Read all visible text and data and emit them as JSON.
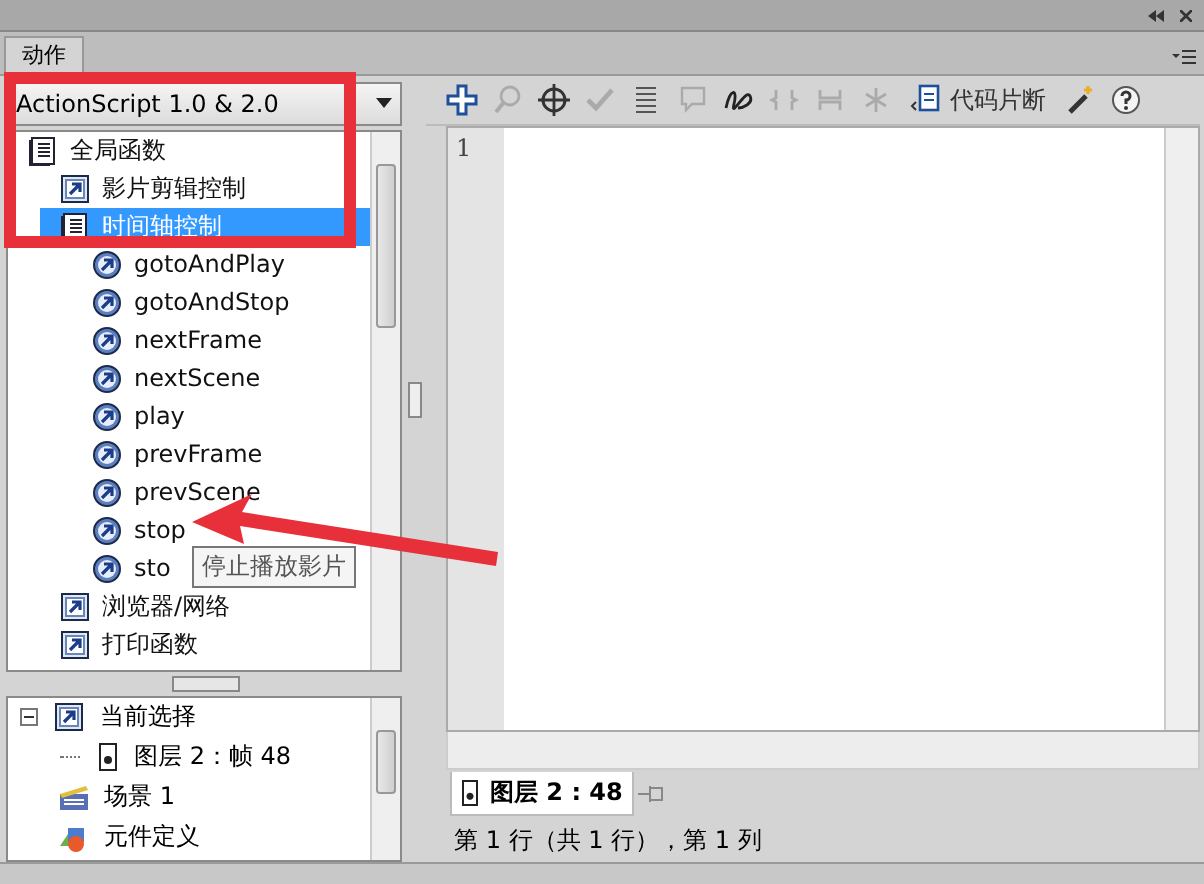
{
  "panel": {
    "tab": "动作"
  },
  "version_dropdown": {
    "value": "ActionScript 1.0 & 2.0"
  },
  "action_tree": [
    {
      "label": "全局函数",
      "kind": "book",
      "selected": false,
      "children": [
        {
          "label": "影片剪辑控制",
          "kind": "category",
          "selected": false
        },
        {
          "label": "时间轴控制",
          "kind": "book",
          "selected": true,
          "children": [
            {
              "label": "gotoAndPlay",
              "kind": "function",
              "selected": false
            },
            {
              "label": "gotoAndStop",
              "kind": "function",
              "selected": false
            },
            {
              "label": "nextFrame",
              "kind": "function",
              "selected": false
            },
            {
              "label": "nextScene",
              "kind": "function",
              "selected": false
            },
            {
              "label": "play",
              "kind": "function",
              "selected": false
            },
            {
              "label": "prevFrame",
              "kind": "function",
              "selected": false
            },
            {
              "label": "prevScene",
              "kind": "function",
              "selected": false
            },
            {
              "label": "stop",
              "kind": "function",
              "selected": false
            },
            {
              "label": "sto",
              "kind": "function",
              "selected": false
            }
          ]
        },
        {
          "label": "浏览器/网络",
          "kind": "category",
          "selected": false
        },
        {
          "label": "打印函数",
          "kind": "category",
          "selected": false
        }
      ]
    }
  ],
  "tooltip": "停止播放影片",
  "script_navigator": [
    {
      "label": "当前选择",
      "kind": "category",
      "expanded": true,
      "children": [
        {
          "label": "图层 2：帧 48",
          "kind": "frame"
        }
      ]
    },
    {
      "label": "场景 1",
      "kind": "scene"
    },
    {
      "label": "元件定义",
      "kind": "symbols"
    }
  ],
  "toolbar": {
    "snippets_label": "代码片断"
  },
  "editor": {
    "line_numbers": [
      "1"
    ]
  },
  "script_tab": {
    "label": "图层 2 : 48"
  },
  "status_bar": "第 1 行（共 1 行），第 1 列"
}
